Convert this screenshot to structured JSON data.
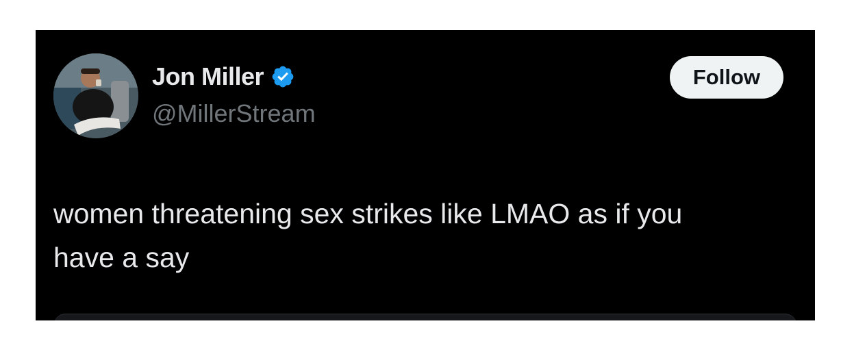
{
  "author": {
    "display_name": "Jon Miller",
    "handle": "@MillerStream",
    "verified": true,
    "verified_badge_color": "#1d9bf0"
  },
  "actions": {
    "follow_label": "Follow"
  },
  "tweet": {
    "text": "women threatening sex strikes like LMAO as if you\nhave a say"
  },
  "colors": {
    "background": "#000000",
    "primary_text": "#e7e9ea",
    "secondary_text": "#71767b",
    "follow_button_bg": "#eff3f4"
  },
  "icons": {
    "verified": "verified-badge-icon",
    "avatar": "profile-avatar"
  }
}
